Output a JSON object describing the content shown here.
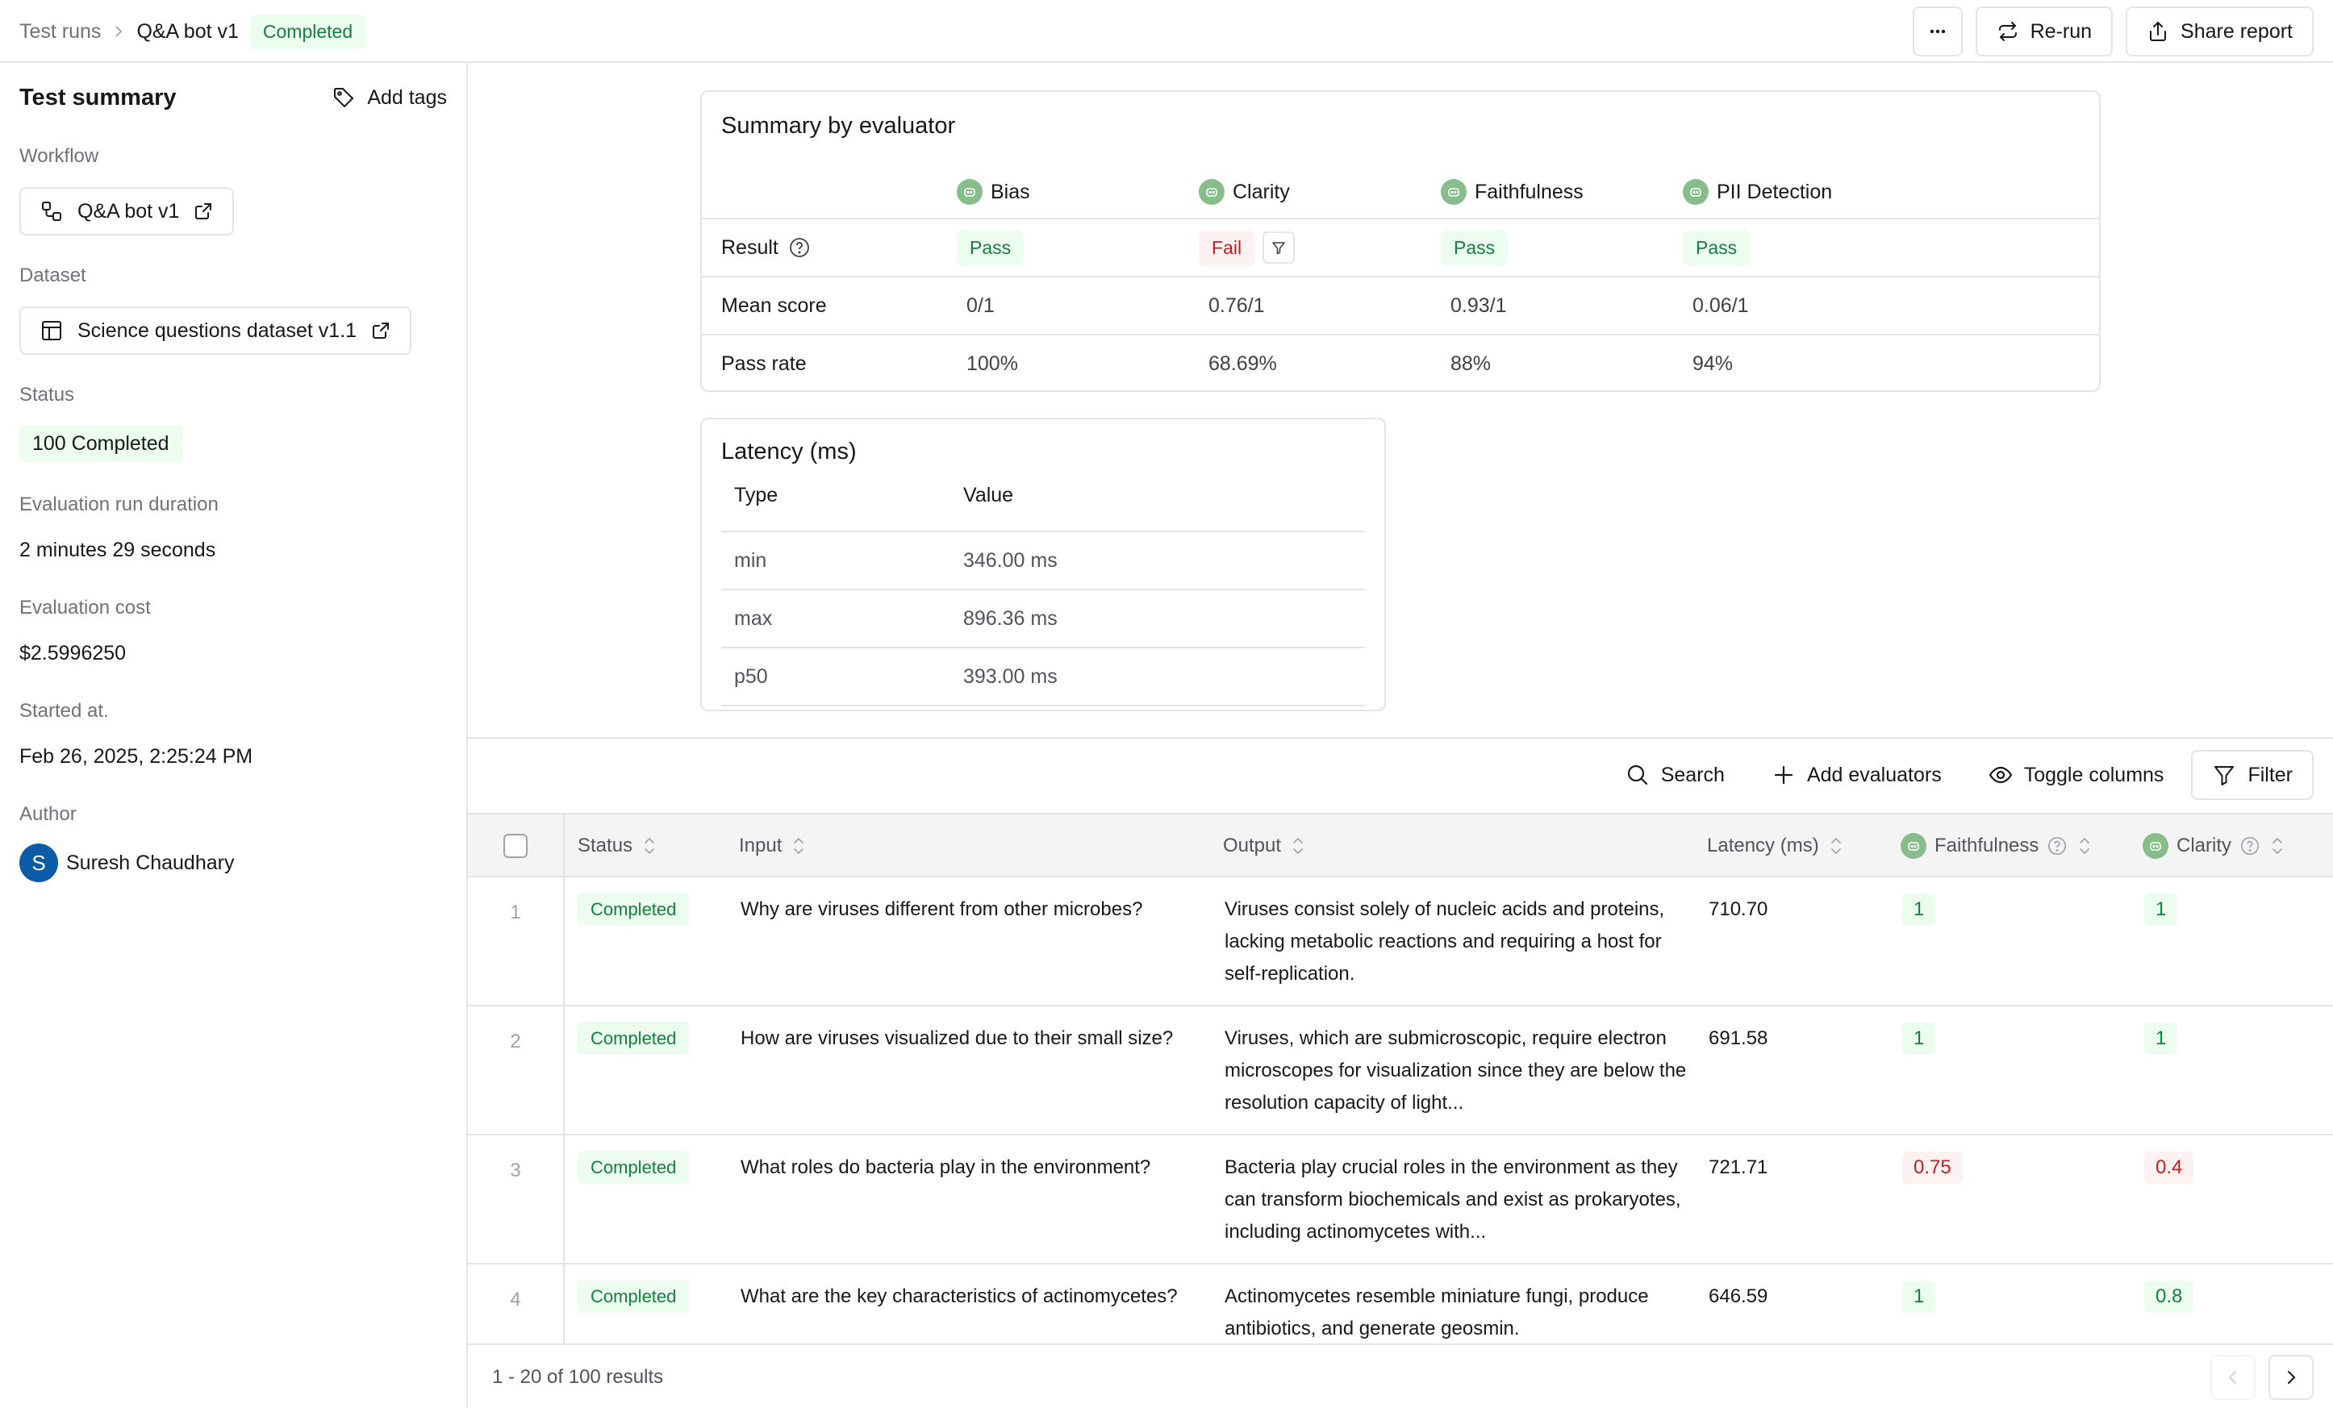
{
  "header": {
    "breadcrumb": {
      "parent": "Test runs",
      "current": "Q&A bot v1"
    },
    "status_badge": "Completed",
    "more_label": "...",
    "rerun_label": "Re-run",
    "share_label": "Share report"
  },
  "sidebar": {
    "title": "Test summary",
    "add_tags_label": "Add tags",
    "workflow": {
      "label": "Workflow",
      "value": "Q&A bot v1"
    },
    "dataset": {
      "label": "Dataset",
      "value": "Science questions dataset v1.1"
    },
    "status": {
      "label": "Status",
      "value": "100 Completed"
    },
    "duration": {
      "label": "Evaluation run duration",
      "value": "2 minutes 29 seconds"
    },
    "cost": {
      "label": "Evaluation cost",
      "value": "$2.5996250"
    },
    "started": {
      "label": "Started at.",
      "value": "Feb 26, 2025, 2:25:24 PM"
    },
    "author": {
      "label": "Author",
      "initial": "S",
      "name": "Suresh Chaudhary"
    }
  },
  "summary": {
    "title": "Summary by evaluator",
    "row_labels": {
      "result": "Result",
      "mean": "Mean score",
      "pass_rate": "Pass rate"
    },
    "evaluators": [
      {
        "name": "Bias",
        "result": "Pass",
        "result_status": "pass",
        "mean": "0/1",
        "pass_rate": "100%"
      },
      {
        "name": "Clarity",
        "result": "Fail",
        "result_status": "fail",
        "mean": "0.76/1",
        "pass_rate": "68.69%"
      },
      {
        "name": "Faithfulness",
        "result": "Pass",
        "result_status": "pass",
        "mean": "0.93/1",
        "pass_rate": "88%"
      },
      {
        "name": "PII Detection",
        "result": "Pass",
        "result_status": "pass",
        "mean": "0.06/1",
        "pass_rate": "94%"
      }
    ]
  },
  "latency": {
    "title": "Latency (ms)",
    "columns": [
      "Type",
      "Value"
    ],
    "rows": [
      {
        "type": "min",
        "value": "346.00 ms"
      },
      {
        "type": "max",
        "value": "896.36 ms"
      },
      {
        "type": "p50",
        "value": "393.00 ms"
      }
    ]
  },
  "toolbar": {
    "search": "Search",
    "add_evaluators": "Add evaluators",
    "toggle_columns": "Toggle columns",
    "filter": "Filter"
  },
  "table": {
    "columns": {
      "status": "Status",
      "input": "Input",
      "output": "Output",
      "latency": "Latency (ms)",
      "faithfulness": "Faithfulness",
      "clarity": "Clarity"
    },
    "rows": [
      {
        "num": "1",
        "status": "Completed",
        "input": "Why are viruses different from other microbes?",
        "output": "Viruses consist solely of nucleic acids and proteins, lacking metabolic reactions and requiring a host for self-replication.",
        "latency": "710.70",
        "faithfulness": "1",
        "faithfulness_ok": true,
        "clarity": "1",
        "clarity_ok": true
      },
      {
        "num": "2",
        "status": "Completed",
        "input": "How are viruses visualized due to their small size?",
        "output": "Viruses, which are submicroscopic, require electron microscopes for visualization since they are below the resolution capacity of light...",
        "latency": "691.58",
        "faithfulness": "1",
        "faithfulness_ok": true,
        "clarity": "1",
        "clarity_ok": true
      },
      {
        "num": "3",
        "status": "Completed",
        "input": "What roles do bacteria play in the environment?",
        "output": "Bacteria play crucial roles in the environment as they can transform biochemicals and exist as prokaryotes, including actinomycetes with...",
        "latency": "721.71",
        "faithfulness": "0.75",
        "faithfulness_ok": false,
        "clarity": "0.4",
        "clarity_ok": false
      },
      {
        "num": "4",
        "status": "Completed",
        "input": "What are the key characteristics of actinomycetes?",
        "output": "Actinomycetes resemble miniature fungi, produce antibiotics, and generate geosmin.",
        "latency": "646.59",
        "faithfulness": "1",
        "faithfulness_ok": true,
        "clarity": "0.8",
        "clarity_ok": true
      }
    ]
  },
  "pagination": {
    "summary": "1 - 20 of 100 results"
  },
  "colors": {
    "pass_bg": "#ecfdf0",
    "pass_fg": "#15803d",
    "fail_bg": "#fef1f1",
    "fail_fg": "#c81e1e",
    "evaluator_icon": "#86bd8a",
    "avatar": "#0b5ba6"
  }
}
